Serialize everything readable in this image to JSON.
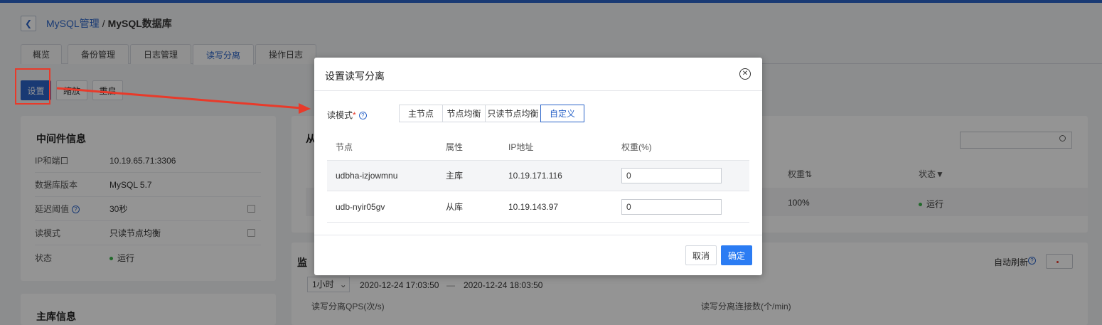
{
  "breadcrumb": {
    "back_icon": "chevron-left-icon",
    "parent": "MySQL管理",
    "separator": "/",
    "current": "MySQL数据库"
  },
  "tabs": [
    {
      "label": "概览"
    },
    {
      "label": "备份管理"
    },
    {
      "label": "日志管理"
    },
    {
      "label": "读写分离",
      "active": true
    },
    {
      "label": "操作日志"
    }
  ],
  "toolbar": {
    "settings": "设置",
    "scale": "缩放",
    "restart": "重启"
  },
  "middleware": {
    "title": "中间件信息",
    "rows": [
      {
        "key": "IP和端口",
        "value": "10.19.65.71:3306"
      },
      {
        "key": "数据库版本",
        "value": "MySQL 5.7"
      },
      {
        "key": "延迟阈值",
        "value": "30秒"
      },
      {
        "key": "读模式",
        "value": "只读节点均衡"
      },
      {
        "key": "状态",
        "value": "运行"
      }
    ]
  },
  "master_card": {
    "title": "主库信息"
  },
  "right_panel": {
    "title_partial": "从",
    "weight_header": "权重⇅",
    "status_header": "状态▼",
    "weight_value": "100%",
    "status_value": "运行"
  },
  "monitor": {
    "title_partial": "监",
    "auto_refresh": "自动刷新",
    "range": "1小时",
    "start": "2020-12-24 17:03:50",
    "dash": "—",
    "end": "2020-12-24 18:03:50",
    "chart1": "读写分离QPS(次/s)",
    "chart2": "读写分离连接数(个/min)"
  },
  "modal": {
    "title": "设置读写分离",
    "mode_label": "读模式",
    "required": "*",
    "modes": [
      "主节点",
      "节点均衡",
      "只读节点均衡",
      "自定义"
    ],
    "selected_mode": "自定义",
    "columns": [
      "节点",
      "属性",
      "IP地址",
      "权重(%)"
    ],
    "rows": [
      {
        "node": "udbha-izjowmnu",
        "attr": "主库",
        "ip": "10.19.171.116",
        "weight": "0"
      },
      {
        "node": "udb-nyir05gv",
        "attr": "从库",
        "ip": "10.19.143.97",
        "weight": "0"
      }
    ],
    "cancel": "取消",
    "confirm": "确定"
  },
  "colors": {
    "accent": "#2b64c8",
    "primary_button": "#2b7cf3",
    "annotation": "#e83a2a",
    "running": "#3bb54a"
  }
}
